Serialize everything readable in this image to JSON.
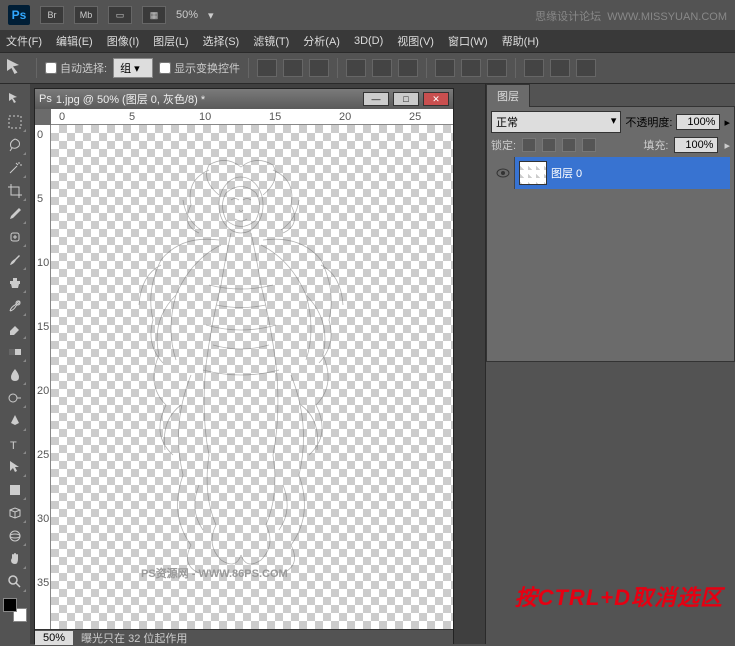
{
  "topbar": {
    "zoom": "50%",
    "watermark_left": "思缘设计论坛",
    "watermark_right": "WWW.MISSYUAN.COM"
  },
  "menu": [
    "文件(F)",
    "编辑(E)",
    "图像(I)",
    "图层(L)",
    "选择(S)",
    "滤镜(T)",
    "分析(A)",
    "3D(D)",
    "视图(V)",
    "窗口(W)",
    "帮助(H)"
  ],
  "options": {
    "auto_select": "自动选择:",
    "group": "组",
    "show_transform": "显示变换控件"
  },
  "document": {
    "title": "1.jpg @ 50% (图层 0, 灰色/8) *"
  },
  "ruler_h": [
    "0",
    "5",
    "10",
    "15",
    "20",
    "25"
  ],
  "ruler_v": [
    "0",
    "5",
    "10",
    "15",
    "20",
    "25",
    "30",
    "35"
  ],
  "art_watermark": "PS资源网 - WWW.86PS.COM",
  "status": {
    "zoom": "50%",
    "info": "曝光只在 32 位起作用"
  },
  "layers_panel": {
    "tab": "图层",
    "blend_mode": "正常",
    "opacity_label": "不透明度:",
    "opacity_value": "100%",
    "lock_label": "锁定:",
    "fill_label": "填充:",
    "fill_value": "100%",
    "layer_name": "图层 0"
  },
  "annotation": "按CTRL+D取消选区"
}
